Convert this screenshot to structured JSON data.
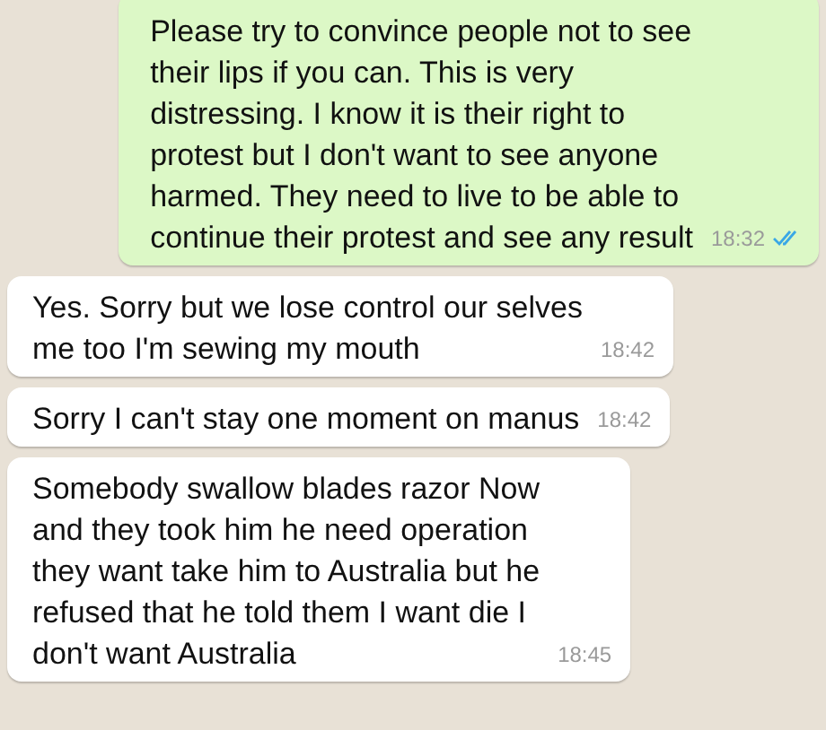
{
  "messages": [
    {
      "kind": "outgoing",
      "text": "Please try to convince people not to see\ntheir lips if you can. This is very\ndistressing. I know it is their right to\nprotest but I don't want to see anyone\nharmed. They need to live to be able to\ncontinue their protest and see any result",
      "time": "18:32",
      "read": true
    },
    {
      "kind": "incoming",
      "text": "Yes. Sorry but we lose control our selves\nme too I'm sewing my mouth",
      "time": "18:42"
    },
    {
      "kind": "incoming",
      "text": "Sorry I can't stay one moment on manus",
      "time": "18:42"
    },
    {
      "kind": "incoming",
      "text": "Somebody swallow blades razor Now\nand they took him he need operation\nthey want take him to Australia but he\nrefused that he told them I want die I\ndon't want Australia",
      "time": "18:45"
    }
  ]
}
